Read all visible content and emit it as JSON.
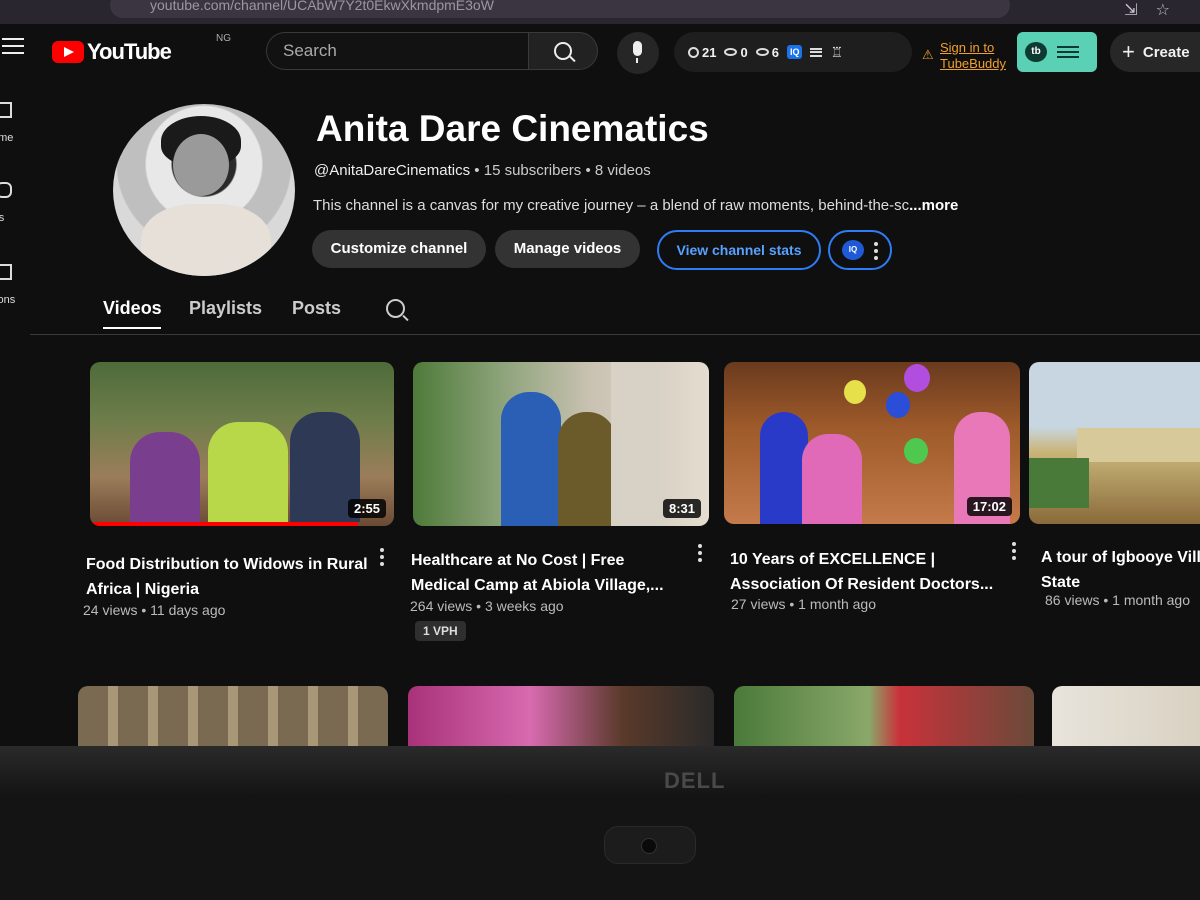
{
  "browser": {
    "url": "youtube.com/channel/UCAbW7Y2t0EkwXkmdpmE3oW"
  },
  "masthead": {
    "logo_text": "YouTube",
    "country": "NG",
    "search_placeholder": "Search",
    "stats": {
      "clock_value": "21",
      "eye_value": "0",
      "views_value": "6",
      "vidiq_badge": "IQ"
    },
    "tubebuddy_signin": "Sign in to TubeBuddy",
    "tubebuddy_logo": "tb",
    "create_label": "Create"
  },
  "guide": {
    "items": [
      {
        "label": "ome",
        "icon": "home-icon"
      },
      {
        "label": "rts",
        "icon": "shorts-icon"
      },
      {
        "label": "tions",
        "icon": "subscriptions-icon"
      }
    ]
  },
  "channel": {
    "name": "Anita Dare Cinematics",
    "handle": "@AnitaDareCinematics",
    "subscribers": "15 subscribers",
    "videos_count": "8 videos",
    "description": "This channel is a canvas for my creative journey – a blend of raw moments, behind-the-sc",
    "more_label": "...more",
    "buttons": {
      "customize": "Customize channel",
      "manage": "Manage videos",
      "stats": "View channel stats",
      "vidiq": "IQ"
    }
  },
  "tabs": [
    {
      "label": "Videos",
      "active": true
    },
    {
      "label": "Playlists",
      "active": false
    },
    {
      "label": "Posts",
      "active": false
    }
  ],
  "videos": [
    {
      "title_line1": "Food Distribution to Widows in Rural",
      "title_line2": "Africa | Nigeria",
      "duration": "2:55",
      "views": "24 views",
      "age": "11 days ago",
      "watched_fraction": 0.88
    },
    {
      "title_line1": "Healthcare at No Cost | Free",
      "title_line2": "Medical Camp at Abiola Village,...",
      "duration": "8:31",
      "views": "264 views",
      "age": "3 weeks ago",
      "badge": "1 VPH"
    },
    {
      "title_line1": "10 Years of EXCELLENCE |",
      "title_line2": "Association Of Resident Doctors...",
      "duration": "17:02",
      "views": "27 views",
      "age": "1 month ago"
    },
    {
      "title_line1": "A tour of Igbooye Villa",
      "title_line2": "State",
      "views": "86 views",
      "age": "1 month ago"
    }
  ],
  "separator": "•",
  "laptop_brand": "DELL",
  "colors": {
    "youtube_red": "#ff0000",
    "vidiq_blue": "#2e7cf6",
    "tubebuddy_green": "#5ad1b5",
    "tubebuddy_orange": "#f0a030"
  }
}
